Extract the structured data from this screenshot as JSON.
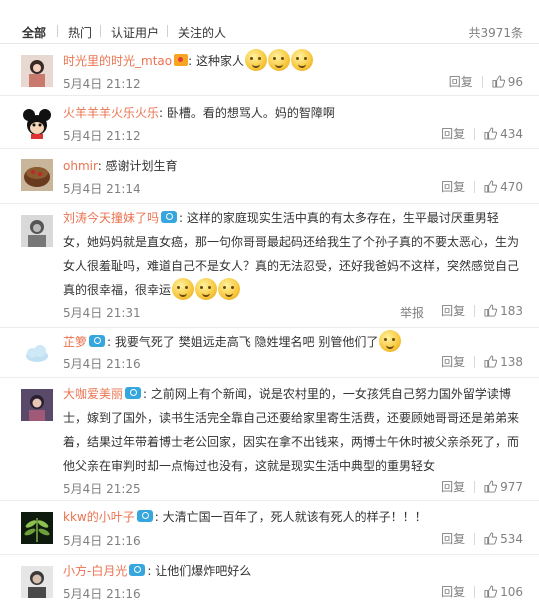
{
  "tabs": {
    "all": "全部",
    "hot": "热门",
    "verified": "认证用户",
    "following": "关注的人",
    "total": "共3971条"
  },
  "actions": {
    "reply": "回复",
    "report": "举报"
  },
  "comments": [
    {
      "user": "时光里的时光_mtao",
      "text": ": 这种家人",
      "time": "5月4日 21:12",
      "likes": "96"
    },
    {
      "user": "火羊羊羊火乐火乐",
      "text": ": 卧槽。看的想骂人。妈的智障啊",
      "time": "5月4日 21:12",
      "likes": "434"
    },
    {
      "user": "ohmir",
      "text": ": 感谢计划生育",
      "time": "5月4日 21:14",
      "likes": "470"
    },
    {
      "user": "刘涛今天撞妹了吗",
      "lines": [
        ": 这样的家庭现实生活中真的有太多存在，生平最讨厌重男轻",
        "女，她妈妈就是直女癌，那一句你哥哥最起码还给我生了个孙子真的不要太恶心，生为",
        "女人很羞耻吗，难道自己不是女人？真的无法忍受，还好我爸妈不这样，突然感觉自己",
        "真的很幸福，很幸运"
      ],
      "time": "5月4日 21:31",
      "likes": "183"
    },
    {
      "user": "芷箩",
      "text": ": 我要气死了 樊姐远走高飞 隐姓埋名吧 别管他们了",
      "time": "5月4日 21:16",
      "likes": "138"
    },
    {
      "user": "大咖爱美丽",
      "lines": [
        ": 之前网上有个新闻，说是农村里的，一女孩凭自己努力国外留学读博",
        "士，嫁到了国外，读书生活完全靠自己还要给家里寄生活费，还要顾她哥哥还是弟弟来",
        "着，结果过年带着博士老公回家，因实在拿不出钱来，两博士午休时被父亲杀死了，而",
        "他父亲在审判时却一点悔过也没有，这就是现实生活中典型的重男轻女"
      ],
      "time": "5月4日 21:25",
      "likes": "977"
    },
    {
      "user": "kkw的小叶子",
      "text": ": 大清亡国一百年了，死人就该有死人的样子！！！",
      "time": "5月4日 21:16",
      "likes": "534"
    },
    {
      "user": "小方-白月光",
      "text": ": 让他们爆炸吧好么",
      "time": "5月4日 21:16",
      "likes": "106"
    }
  ],
  "colors": {
    "username": "#eb7350",
    "badge": "#35a6de",
    "meta": "#808080"
  }
}
